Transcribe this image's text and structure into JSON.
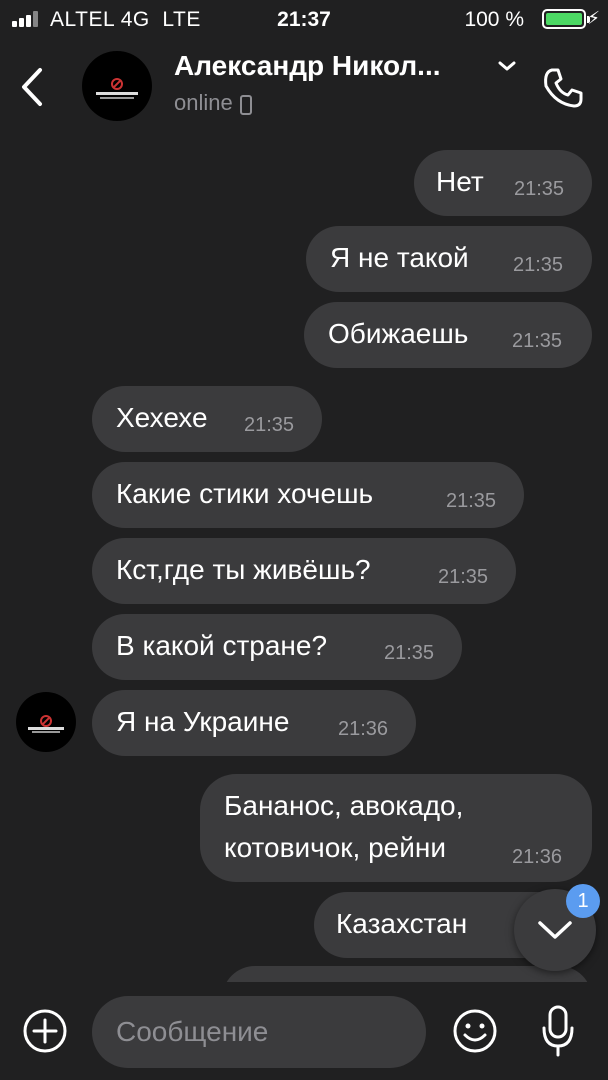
{
  "status_bar": {
    "carrier": "ALTEL 4G",
    "network": "LTE",
    "time": "21:37",
    "battery": "100 %"
  },
  "header": {
    "name": "Александр Никол...",
    "status": "online"
  },
  "messages": [
    {
      "dir": "out",
      "text": "Нет",
      "time": "21:35"
    },
    {
      "dir": "out",
      "text": "Я не такой",
      "time": "21:35"
    },
    {
      "dir": "out",
      "text": "Обижаешь",
      "time": "21:35"
    },
    {
      "dir": "in",
      "text": "Хехехе",
      "time": "21:35"
    },
    {
      "dir": "in",
      "text": "Какие стики хочешь",
      "time": "21:35"
    },
    {
      "dir": "in",
      "text": "Кст,где ты живёшь?",
      "time": "21:35"
    },
    {
      "dir": "in",
      "text": "В какой стране?",
      "time": "21:35"
    },
    {
      "dir": "in",
      "text": "Я на Украине",
      "time": "21:36"
    },
    {
      "dir": "out",
      "text_line1": "Бананос, авокадо,",
      "text_line2": "котовичок, рейни",
      "time": "21:36"
    },
    {
      "dir": "out",
      "text": "Казахстан",
      "time": ""
    }
  ],
  "scroll_badge": "1",
  "composer": {
    "placeholder": "Сообщение"
  }
}
